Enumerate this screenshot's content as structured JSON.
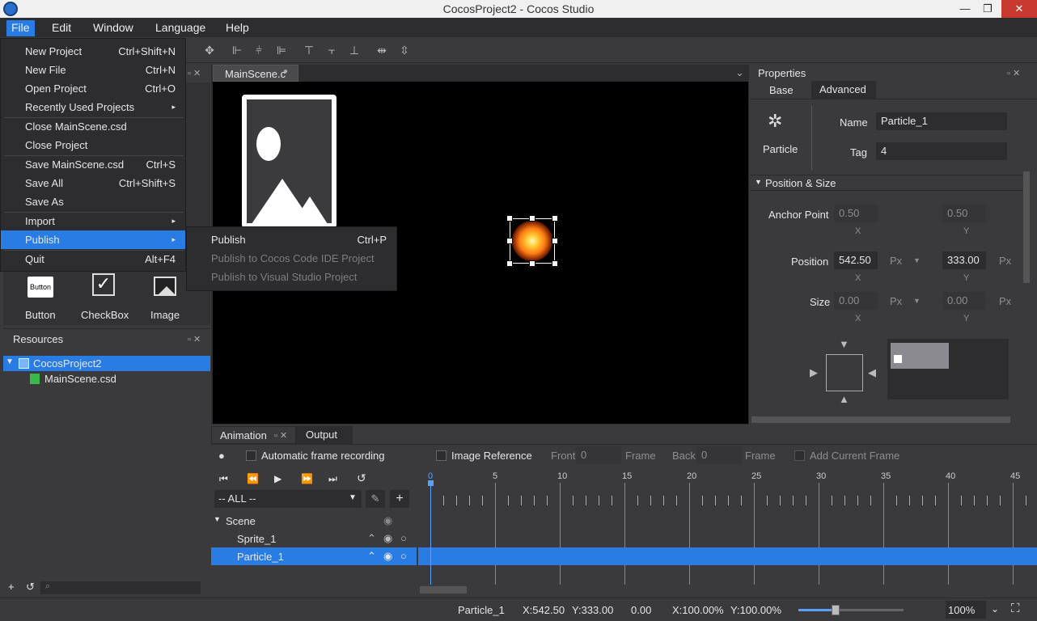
{
  "window": {
    "title": "CocosProject2 - Cocos Studio",
    "minimize": "—",
    "restore": "❐",
    "close": "✕"
  },
  "menubar": [
    "File",
    "Edit",
    "Window",
    "Language",
    "Help"
  ],
  "file_menu": [
    {
      "label": "New Project",
      "shortcut": "Ctrl+Shift+N"
    },
    {
      "label": "New File",
      "shortcut": "Ctrl+N"
    },
    {
      "label": "Open Project",
      "shortcut": "Ctrl+O"
    },
    {
      "label": "Recently Used Projects",
      "shortcut": "▸"
    },
    {
      "label": "Close MainScene.csd",
      "shortcut": ""
    },
    {
      "label": "Close Project",
      "shortcut": ""
    },
    {
      "label": "Save MainScene.csd",
      "shortcut": "Ctrl+S"
    },
    {
      "label": "Save All",
      "shortcut": "Ctrl+Shift+S"
    },
    {
      "label": "Save As",
      "shortcut": ""
    },
    {
      "label": "Import",
      "shortcut": "▸"
    },
    {
      "label": "Publish",
      "shortcut": "▸"
    },
    {
      "label": "Quit",
      "shortcut": "Alt+F4"
    }
  ],
  "publish_submenu": [
    {
      "label": "Publish",
      "shortcut": "Ctrl+P",
      "enabled": true
    },
    {
      "label": "Publish to Cocos Code IDE Project",
      "shortcut": "",
      "enabled": false
    },
    {
      "label": "Publish to Visual Studio Project",
      "shortcut": "",
      "enabled": false
    }
  ],
  "controls_panel": {
    "items": [
      {
        "label": "Button",
        "icon": "Button"
      },
      {
        "label": "CheckBox",
        "icon": "✓"
      },
      {
        "label": "Image",
        "icon": "image"
      }
    ]
  },
  "resources": {
    "title": "Resources",
    "project": "CocosProject2",
    "file": "MainScene.csd"
  },
  "editor_tab": {
    "label": "MainScene.c"
  },
  "properties": {
    "title": "Properties",
    "tabs": [
      "Base",
      "Advanced"
    ],
    "node_type": "Particle",
    "name_label": "Name",
    "name_value": "Particle_1",
    "tag_label": "Tag",
    "tag_value": "4",
    "section": "Position & Size",
    "anchor_label": "Anchor Point",
    "anchor_x": "0.50",
    "anchor_y": "0.50",
    "position_label": "Position",
    "pos_x": "542.50",
    "pos_y": "333.00",
    "size_label": "Size",
    "size_x": "0.00",
    "size_y": "0.00",
    "unit": "Px",
    "x": "X",
    "y": "Y"
  },
  "animation": {
    "tabs": [
      "Animation",
      "Output"
    ],
    "auto_record": "Automatic frame recording",
    "image_ref": "Image Reference",
    "front_label": "Front",
    "front_value": "0",
    "frame_label": "Frame",
    "back_label": "Back",
    "back_value": "0",
    "add_frame": "Add Current Frame",
    "filter": "-- ALL --",
    "timeline_marks": [
      "0",
      "5",
      "10",
      "15",
      "20",
      "25",
      "30",
      "35",
      "40",
      "45"
    ],
    "tree": [
      {
        "label": "Scene",
        "selected": false
      },
      {
        "label": "Sprite_1",
        "selected": false
      },
      {
        "label": "Particle_1",
        "selected": true
      }
    ]
  },
  "statusbar": {
    "node": "Particle_1",
    "x": "X:542.50",
    "y": "Y:333.00",
    "rotation": "0.00",
    "scale_x": "X:100.00%",
    "scale_y": "Y:100.00%",
    "zoom": "100%",
    "zoom_level": 0.35
  }
}
